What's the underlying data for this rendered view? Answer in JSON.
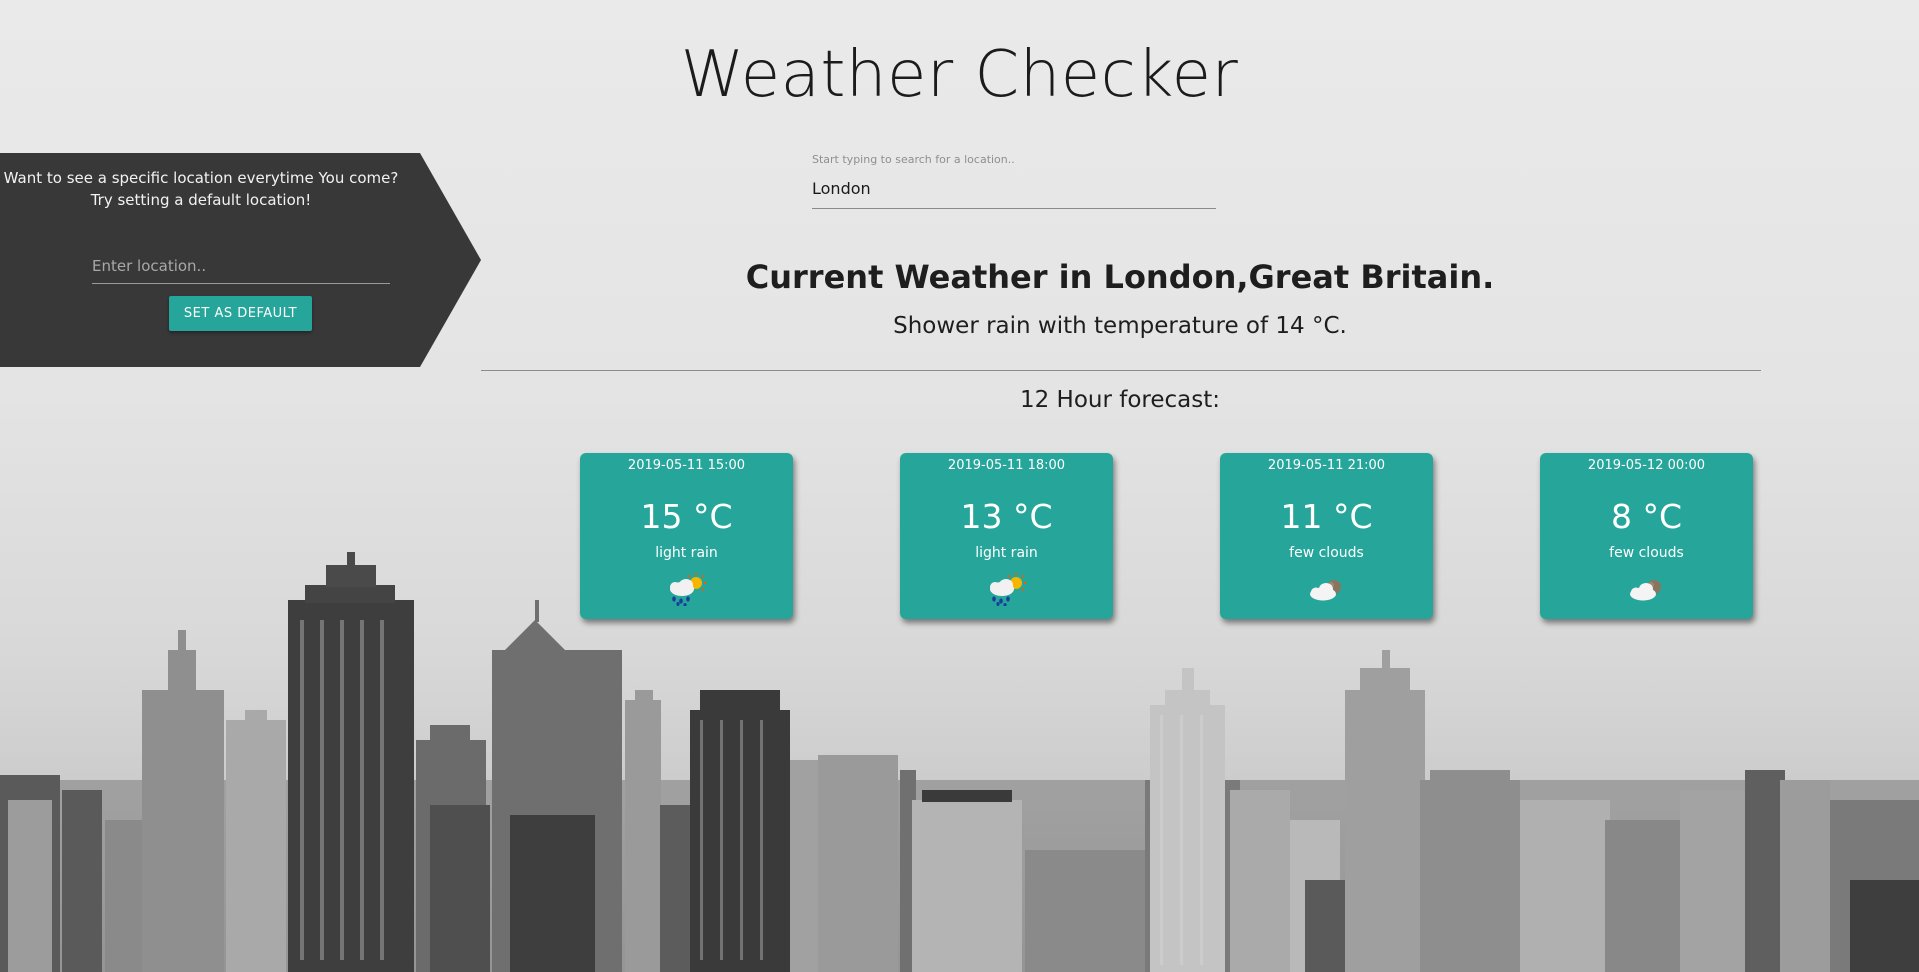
{
  "app": {
    "title": "Weather Checker"
  },
  "default_panel": {
    "message_line1": "Want to see a specific location everytime You come?",
    "message_line2": "Try setting a default location!",
    "input_placeholder": "Enter location..",
    "button_label": "SET AS DEFAULT",
    "background_color": "#383838",
    "button_color": "#26a69a"
  },
  "search": {
    "label": "Start typing to search for a location..",
    "value": "London"
  },
  "current": {
    "heading": "Current Weather in London,Great Britain.",
    "summary": "Shower rain with temperature of 14 °C."
  },
  "forecast": {
    "title": "12 Hour forecast:",
    "card_color": "#26a69a",
    "items": [
      {
        "time": "2019-05-11 15:00",
        "temp": "15 °C",
        "desc": "light rain",
        "icon": "rain-sun-icon"
      },
      {
        "time": "2019-05-11 18:00",
        "temp": "13 °C",
        "desc": "light rain",
        "icon": "rain-sun-icon"
      },
      {
        "time": "2019-05-11 21:00",
        "temp": "11 °C",
        "desc": "few clouds",
        "icon": "cloud-moon-icon"
      },
      {
        "time": "2019-05-12 00:00",
        "temp": "8 °C",
        "desc": "few clouds",
        "icon": "cloud-moon-icon"
      }
    ]
  }
}
